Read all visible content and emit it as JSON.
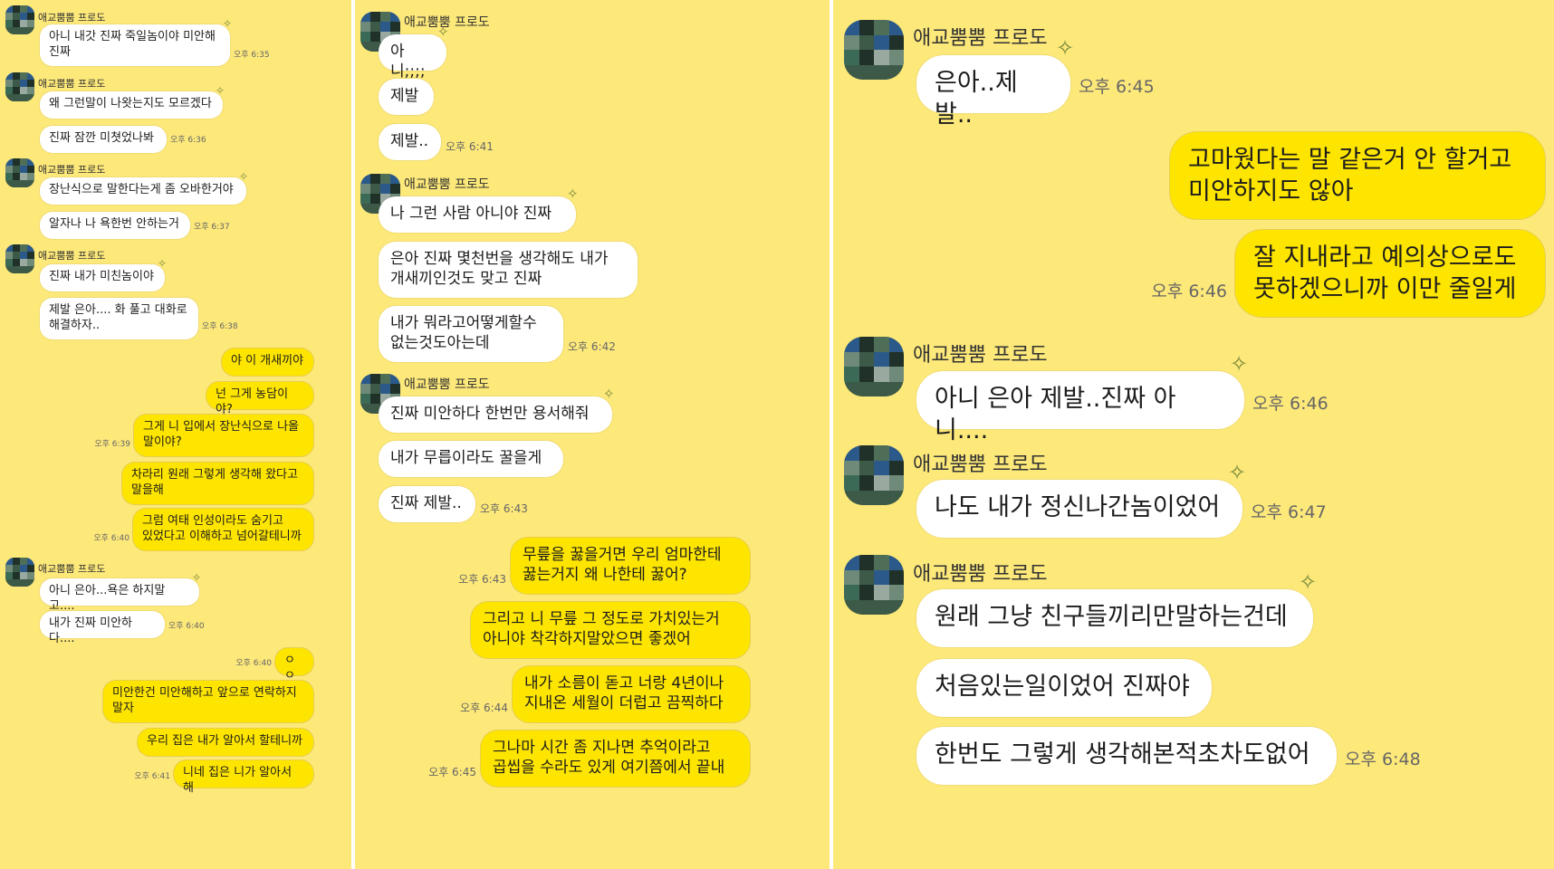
{
  "contact_name": "애교뿜뿜 프로도",
  "colors": {
    "background": "#fde87a",
    "incoming_bubble": "#ffffff",
    "outgoing_bubble": "#fee500"
  },
  "icons": {
    "profile": "avatar-pixelated",
    "sticker": "sparkle-icon"
  },
  "panels": [
    {
      "messages": [
        {
          "side": "in",
          "sender": "애교뿜뿜 프로도",
          "text": "아니 내갓 진짜 죽일놈이야 미안해\n진짜",
          "time": "오후 6:35"
        },
        {
          "side": "in",
          "sender": "애교뿜뿜 프로도",
          "text": "왜 그런말이 나왓는지도 모르겠다",
          "time": ""
        },
        {
          "side": "in",
          "sender": "",
          "text": "진짜 잠깐 미쳣었나봐",
          "time": "오후 6:36"
        },
        {
          "side": "in",
          "sender": "애교뿜뿜 프로도",
          "text": "장난식으로 말한다는게 좀 오바한거야",
          "time": ""
        },
        {
          "side": "in",
          "sender": "",
          "text": "알자나 나 욕한번 안하는거",
          "time": "오후 6:37"
        },
        {
          "side": "in",
          "sender": "애교뿜뿜 프로도",
          "text": "진짜 내가 미친놈이야",
          "time": ""
        },
        {
          "side": "in",
          "sender": "",
          "text": "제발 은아.... 화 풀고 대화로\n해결하자..",
          "time": "오후 6:38"
        },
        {
          "side": "out",
          "text": "야 이 개새끼야",
          "time": ""
        },
        {
          "side": "out",
          "text": "넌 그게 농담이야?",
          "time": ""
        },
        {
          "side": "out",
          "text": "그게 니 입에서 장난식으로 나올\n말이야?",
          "time": "오후 6:39"
        },
        {
          "side": "out",
          "text": "차라리 원래 그렇게 생각해 왔다고\n말을해",
          "time": ""
        },
        {
          "side": "out",
          "text": "그럼 여태 인성이라도 숨기고\n있었다고 이해하고 넘어갈테니까",
          "time": "오후 6:40"
        },
        {
          "side": "in",
          "sender": "애교뿜뿜 프로도",
          "text": "아니 은아...욕은 하지말고....",
          "time": ""
        },
        {
          "side": "in",
          "sender": "",
          "text": "내가 진짜 미안하다....",
          "time": "오후 6:40"
        },
        {
          "side": "out",
          "text": "ㅇㅇ",
          "time": "오후 6:40"
        },
        {
          "side": "out",
          "text": "미안한건 미안해하고 앞으로 연락하지\n말자",
          "time": ""
        },
        {
          "side": "out",
          "text": "우리 집은 내가 알아서 할테니까",
          "time": ""
        },
        {
          "side": "out",
          "text": "니네 집은 니가 알아서 해",
          "time": "오후 6:41"
        }
      ]
    },
    {
      "messages": [
        {
          "side": "in",
          "sender": "애교뿜뿜 프로도",
          "text": "아니;;;;",
          "time": ""
        },
        {
          "side": "in",
          "sender": "",
          "text": "제발",
          "time": ""
        },
        {
          "side": "in",
          "sender": "",
          "text": "제발..",
          "time": "오후 6:41"
        },
        {
          "side": "in",
          "sender": "애교뿜뿜 프로도",
          "text": "나 그런 사람 아니야 진짜",
          "time": ""
        },
        {
          "side": "in",
          "sender": "",
          "text": "은아 진짜 몇천번을 생각해도 내가\n개새끼인것도 맞고 진짜",
          "time": ""
        },
        {
          "side": "in",
          "sender": "",
          "text": "내가 뭐라고어떻게할수\n없는것도아는데",
          "time": "오후 6:42"
        },
        {
          "side": "in",
          "sender": "애교뿜뿜 프로도",
          "text": "진짜 미안하다 한번만 용서해줘",
          "time": ""
        },
        {
          "side": "in",
          "sender": "",
          "text": "내가 무릅이라도 꿀을게",
          "time": ""
        },
        {
          "side": "in",
          "sender": "",
          "text": "진짜 제발..",
          "time": "오후 6:43"
        },
        {
          "side": "out",
          "text": "무릎을 꿇을거면 우리 엄마한테\n꿇는거지 왜 나한테 꿇어?",
          "time": "오후 6:43"
        },
        {
          "side": "out",
          "text": "그리고 니 무릎 그 정도로 가치있는거\n아니야 착각하지말았으면 좋겠어",
          "time": ""
        },
        {
          "side": "out",
          "text": "내가 소름이 돋고 너랑 4년이나\n지내온 세월이 더럽고 끔찍하다",
          "time": "오후 6:44"
        },
        {
          "side": "out",
          "text": "그나마 시간 좀 지나면 추억이라고\n곱씹을 수라도 있게 여기쯤에서 끝내",
          "time": "오후 6:45"
        }
      ]
    },
    {
      "messages": [
        {
          "side": "in",
          "sender": "애교뿜뿜 프로도",
          "text": "은아..제발..",
          "time": "오후 6:45"
        },
        {
          "side": "out",
          "text": "고마웠다는 말 같은거 안 할거고\n미안하지도 않아",
          "time": ""
        },
        {
          "side": "out",
          "text": "잘 지내라고 예의상으로도\n못하겠으니까 이만 줄일게",
          "time": "오후 6:46"
        },
        {
          "side": "in",
          "sender": "애교뿜뿜 프로도",
          "text": "아니 은아 제발..진짜 아니....",
          "time": "오후 6:46"
        },
        {
          "side": "in",
          "sender": "애교뿜뿜 프로도",
          "text": "나도 내가 정신나간놈이었어",
          "time": "오후 6:47"
        },
        {
          "side": "in",
          "sender": "애교뿜뿜 프로도",
          "text": "원래 그냥 친구들끼리만말하는건데",
          "time": ""
        },
        {
          "side": "in",
          "sender": "",
          "text": "처음있는일이었어 진짜야",
          "time": ""
        },
        {
          "side": "in",
          "sender": "",
          "text": "한번도 그렇게 생각해본적초차도없어",
          "time": "오후 6:48"
        }
      ]
    }
  ]
}
